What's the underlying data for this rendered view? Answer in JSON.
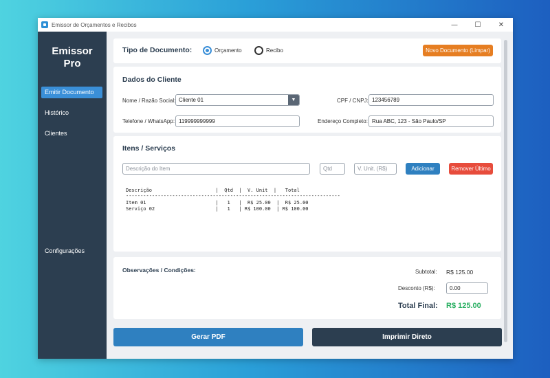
{
  "window": {
    "title": "Emissor de Orçamentos e Recibos",
    "controls": {
      "minimize": "—",
      "maximize": "☐",
      "close": "✕"
    }
  },
  "sidebar": {
    "brand_line1": "Emissor",
    "brand_line2": "Pro",
    "items": [
      {
        "label": "Emitir Documento",
        "active": true
      },
      {
        "label": "Histórico"
      },
      {
        "label": "Clientes"
      }
    ],
    "settings_label": "Configurações"
  },
  "doc_type": {
    "label": "Tipo de Documento:",
    "options": [
      {
        "label": "Orçamento",
        "checked": true
      },
      {
        "label": "Recibo",
        "checked": false
      }
    ],
    "new_button": "Novo Documento (Limpar)"
  },
  "client": {
    "heading": "Dados do Cliente",
    "name_label": "Nome / Razão Social:",
    "name_value": "Cliente 01",
    "cpf_label": "CPF / CNPJ:",
    "cpf_value": "123456789",
    "phone_label": "Telefone / WhatsApp:",
    "phone_value": "119999999999",
    "address_label": "Endereço Completo:",
    "address_value": "Rua ABC, 123 - São Paulo/SP"
  },
  "items": {
    "heading": "Itens / Serviços",
    "desc_placeholder": "Descrição do Item",
    "qty_placeholder": "Qtd",
    "unit_placeholder": "V. Unit. (R$)",
    "add_button": "Adicionar",
    "remove_button": "Remover Último",
    "table_header": "Descrição                      |  Qtd  |  V. Unit  |   Total",
    "table_separator": "--------------------------------------------------------------------------",
    "table_rows": [
      "Item 01                        |   1   |  R$ 25.00  |  R$ 25.00",
      "Serviço 02                     |   1   | R$ 100.00  | R$ 100.00"
    ]
  },
  "summary": {
    "notes_label": "Observações / Condições:",
    "subtotal_label": "Subtotal:",
    "subtotal_value": "R$ 125.00",
    "discount_label": "Desconto (R$):",
    "discount_value": "0.00",
    "total_label": "Total Final:",
    "total_value": "R$ 125.00"
  },
  "actions": {
    "pdf_button": "Gerar PDF",
    "print_button": "Imprimir Direto"
  },
  "colors": {
    "sidebar": "#2c3e50",
    "accent_blue": "#3a8fd8",
    "orange": "#e67e22",
    "red": "#e74c3c",
    "green": "#27ae60",
    "pdf_button": "#2f80c0",
    "print_button": "#2c3e50"
  }
}
